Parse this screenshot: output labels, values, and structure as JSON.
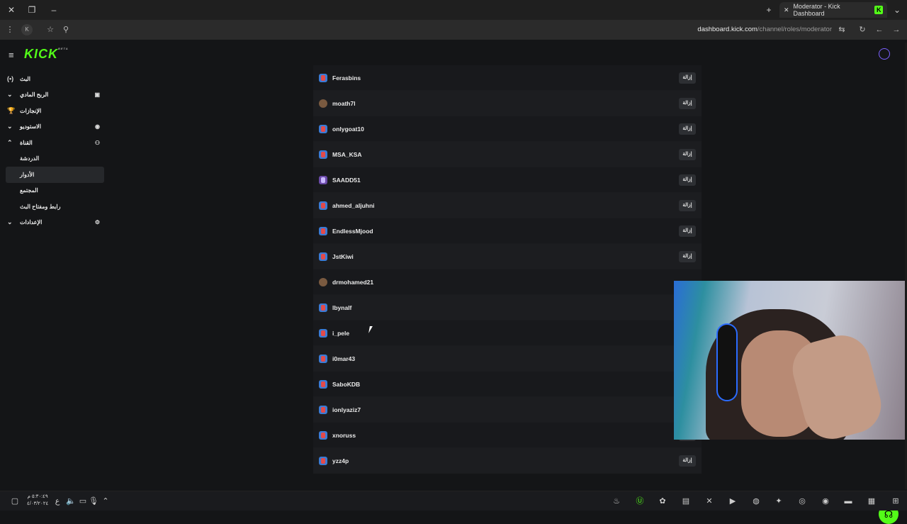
{
  "browser": {
    "tab_title": "Moderator - Kick Dashboard",
    "url_host": "dashboard.kick.com",
    "url_path": "/channel/roles/moderator"
  },
  "app": {
    "logo": "KICK",
    "logo_badge": "BETA"
  },
  "sidebar": {
    "items": [
      {
        "label": "البث",
        "icon": "broadcast-icon"
      },
      {
        "label": "الربح المادي",
        "icon": "chart-icon"
      },
      {
        "label": "الإنجازات",
        "icon": "trophy-icon"
      },
      {
        "label": "الاستوديو",
        "icon": "camera-icon"
      },
      {
        "label": "القناة",
        "icon": "users-icon"
      },
      {
        "label": "الإعدادات",
        "icon": "gear-icon"
      }
    ],
    "channel_sub": [
      "الدردشة",
      "الأدوار",
      "المجتمع",
      "رابط ومفتاح البث"
    ]
  },
  "moderators": {
    "remove_label": "إزالة",
    "rows": [
      "Ferasbins",
      "moath7l",
      "onlygoat10",
      "MSA_KSA",
      "SAADD51",
      "ahmed_aljuhni",
      "EndlessMjood",
      "JstKiwi",
      "drmohamed21",
      "lbynalf",
      "i_pele",
      "i0mar43",
      "SaboKDB",
      "ionlyaziz7",
      "xnoruss",
      "yzz4p"
    ]
  },
  "taskbar": {
    "time": "٥:٣٠:٤٩ م",
    "date": "٤/٠٣/٢٠٢٤",
    "lang": "ع"
  }
}
